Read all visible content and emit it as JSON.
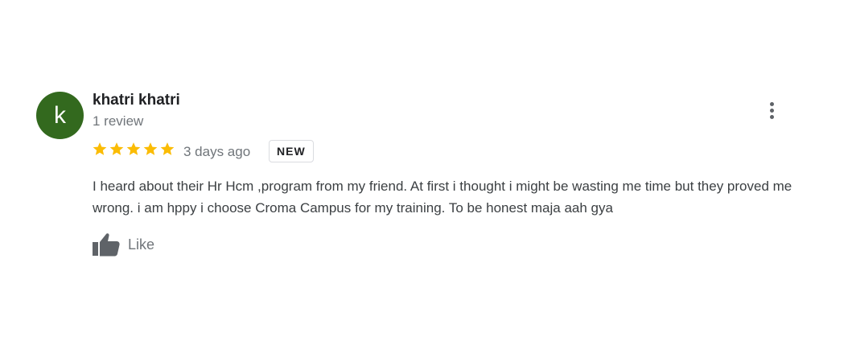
{
  "review": {
    "avatar_letter": "k",
    "author": "khatri khatri",
    "review_count": "1 review",
    "rating": 5,
    "rating_max": 5,
    "star_color": "#fbbc04",
    "date": "3 days ago",
    "badge": "NEW",
    "text": "I heard about their Hr Hcm ,program from my friend. At first i thought i might be wasting me time but they proved me wrong. i am hppy i choose Croma Campus for my training. To be honest maja aah gya",
    "like_label": "Like",
    "icons": {
      "menu": "more-vertical-icon",
      "like": "thumbs-up-icon",
      "star": "star-icon"
    }
  }
}
